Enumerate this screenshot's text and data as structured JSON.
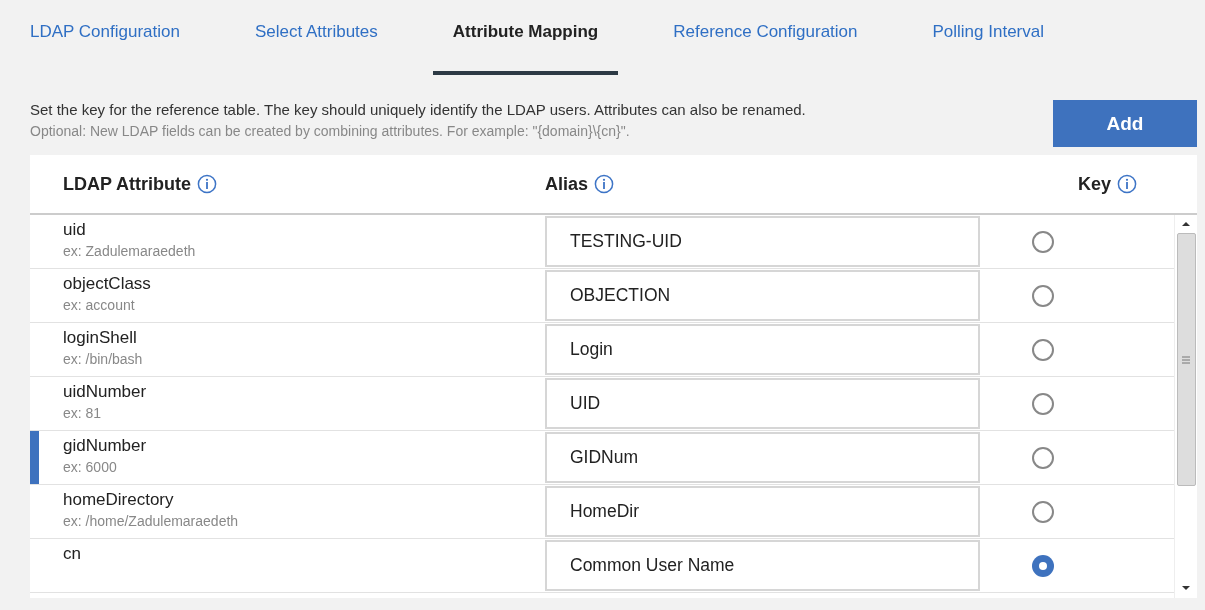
{
  "tabs": [
    {
      "label": "LDAP Configuration",
      "selected": false
    },
    {
      "label": "Select Attributes",
      "selected": false
    },
    {
      "label": "Attribute Mapping",
      "selected": true
    },
    {
      "label": "Reference Configuration",
      "selected": false
    },
    {
      "label": "Polling Interval",
      "selected": false
    }
  ],
  "description": {
    "text": "Set the key for the reference table. The key should uniquely identify the LDAP users. Attributes can also be renamed.",
    "hint": "Optional: New LDAP fields can be created by combining attributes. For example: \"{domain}\\{cn}\"."
  },
  "add_button": {
    "label": "Add"
  },
  "table": {
    "columns": [
      {
        "label": "LDAP Attribute"
      },
      {
        "label": "Alias"
      },
      {
        "label": "Key"
      }
    ],
    "rows": [
      {
        "attribute": "uid",
        "example": "ex: Zadulemaraedeth",
        "alias": "TESTING-UID",
        "checked": false,
        "selected": false
      },
      {
        "attribute": "objectClass",
        "example": "ex: account",
        "alias": "OBJECTION",
        "checked": false,
        "selected": false
      },
      {
        "attribute": "loginShell",
        "example": "ex: /bin/bash",
        "alias": "Login",
        "checked": false,
        "selected": false
      },
      {
        "attribute": "uidNumber",
        "example": "ex: 81",
        "alias": "UID",
        "checked": false,
        "selected": false
      },
      {
        "attribute": "gidNumber",
        "example": "ex: 6000",
        "alias": "GIDNum",
        "checked": false,
        "selected": true
      },
      {
        "attribute": "homeDirectory",
        "example": "ex: /home/Zadulemaraedeth",
        "alias": "HomeDir",
        "checked": false,
        "selected": false
      },
      {
        "attribute": "cn",
        "alias": "Common User Name",
        "checked": true,
        "selected": false
      }
    ]
  }
}
